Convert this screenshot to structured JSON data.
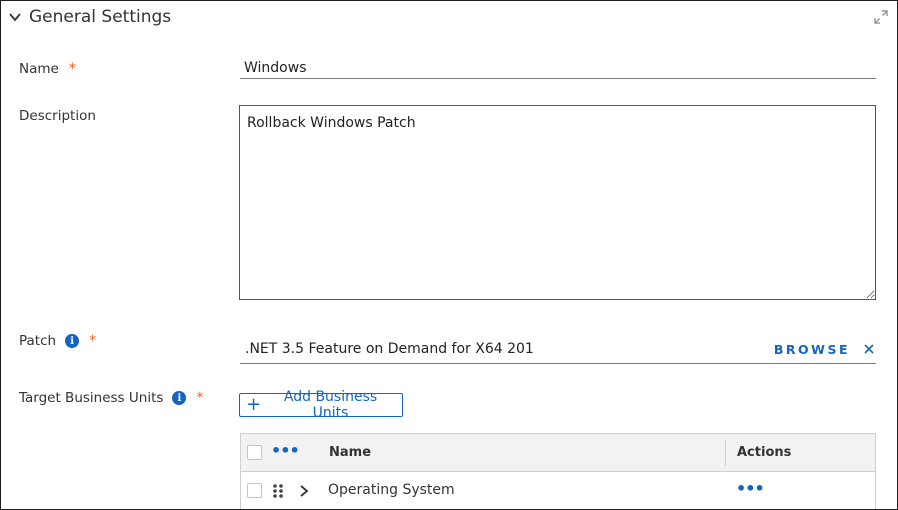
{
  "section": {
    "title": "General Settings"
  },
  "fields": {
    "name": {
      "label": "Name",
      "required_mark": "*",
      "value": "Windows"
    },
    "description": {
      "label": "Description",
      "value": "Rollback Windows Patch"
    },
    "patch": {
      "label": "Patch",
      "required_mark": "*",
      "value": ".NET 3.5 Feature on Demand for X64 201",
      "browse_label": "BROWSE"
    },
    "target_bu": {
      "label": "Target Business Units",
      "required_mark": "*",
      "add_button_label": "Add Business Units"
    }
  },
  "grid": {
    "columns": {
      "name": "Name",
      "actions": "Actions"
    },
    "rows": [
      {
        "name": "Operating System"
      }
    ]
  },
  "colors": {
    "accent": "#1565c0",
    "required": "#e8641b"
  },
  "icons": {
    "info": "i",
    "more": "•••",
    "plus": "+"
  }
}
